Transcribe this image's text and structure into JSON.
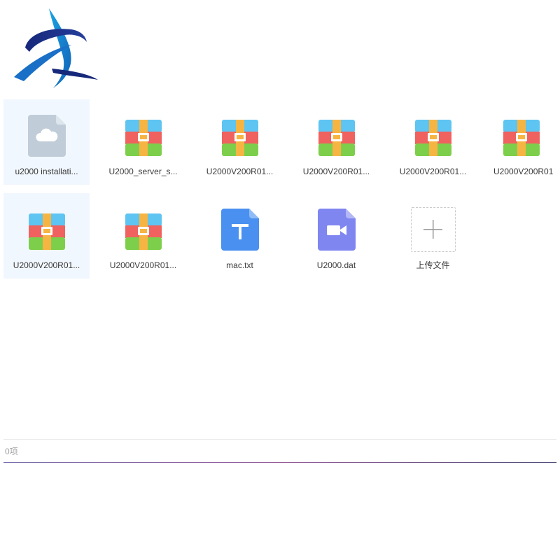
{
  "logo": {
    "icon": "star-swirl-logo",
    "colors": [
      "#1b2f7a",
      "#1e8ad4"
    ]
  },
  "files": [
    {
      "name": "u2000 installati...",
      "type": "cloud-file",
      "selected": true
    },
    {
      "name": "U2000_server_s...",
      "type": "archive",
      "selected": false
    },
    {
      "name": "U2000V200R01...",
      "type": "archive",
      "selected": false
    },
    {
      "name": "U2000V200R01...",
      "type": "archive",
      "selected": false
    },
    {
      "name": "U2000V200R01...",
      "type": "archive",
      "selected": false
    },
    {
      "name": "U2000V200R01",
      "type": "archive",
      "selected": false
    },
    {
      "name": "U2000V200R01...",
      "type": "archive",
      "selected": true
    },
    {
      "name": "U2000V200R01...",
      "type": "archive",
      "selected": false
    },
    {
      "name": "mac.txt",
      "type": "text",
      "selected": false
    },
    {
      "name": "U2000.dat",
      "type": "video",
      "selected": false
    }
  ],
  "upload": {
    "label": "上传文件",
    "icon": "plus-icon"
  },
  "footer": {
    "count_text": "0项"
  },
  "colors": {
    "archive_top": "#5ec4f2",
    "archive_mid": "#f0625f",
    "archive_bottom": "#7dcf4b",
    "archive_strap": "#f6b543",
    "text_file": "#4a90f0",
    "video_file": "#7f86f0",
    "cloud_file": "#c0cdd9"
  }
}
